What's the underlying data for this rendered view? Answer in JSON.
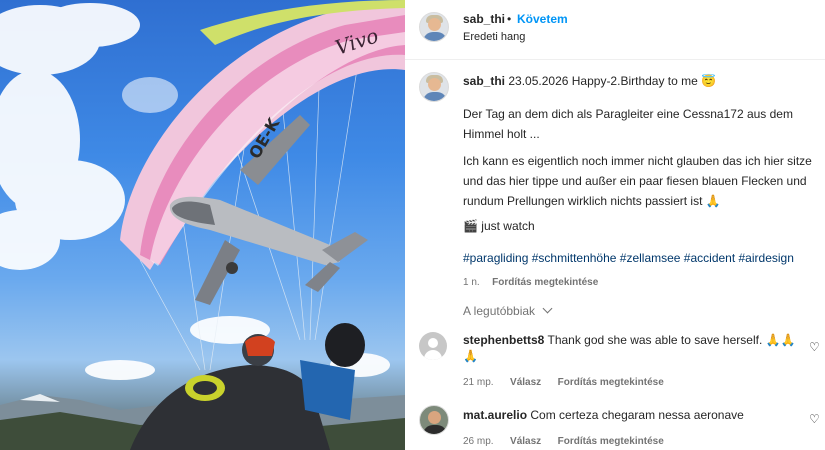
{
  "post": {
    "username": "sab_thi",
    "separator": "•",
    "follow_label": "Követem",
    "audio": "Eredeti hang"
  },
  "caption": {
    "username": "sab_thi",
    "date_text": "23.05.2026 Happy-2.Birthday to me",
    "date_emoji": "😇",
    "paragraph1": "Der Tag an dem dich als Paragleiter eine Cessna172 aus dem Himmel holt ...",
    "paragraph2": "Ich kann es eigentlich noch immer nicht glauben das ich hier sitze und das hier tippe und außer ein paar fiesen blauen Flecken und rundum Prellungen wirklich nichts passiert ist",
    "paragraph2_emoji": "🙏",
    "watch_emoji": "🎬",
    "watch_text": "just watch",
    "hashtags": "#paragliding #schmittenhöhe #zellamsee #accident #airdesign",
    "age": "1 n.",
    "translate": "Fordítás megtekintése"
  },
  "sort_label": "A legutóbbiak",
  "comments": [
    {
      "username": "stephenbetts8",
      "text": "Thank god she was able to save herself.",
      "emojis": "🙏🙏",
      "emoji_line2": "🙏",
      "age": "21 mp.",
      "reply": "Válasz",
      "translate": "Fordítás megtekintése"
    },
    {
      "username": "mat.aurelio",
      "text": "Com certeza chegaram nessa aeronave",
      "age": "26 mp.",
      "reply": "Válasz",
      "translate": "Fordítás megtekintése"
    }
  ],
  "media": {
    "wing_text": "Vivo",
    "registration": "OE-K"
  },
  "colors": {
    "accent": "#0095f6",
    "hashtag": "#00376b"
  }
}
